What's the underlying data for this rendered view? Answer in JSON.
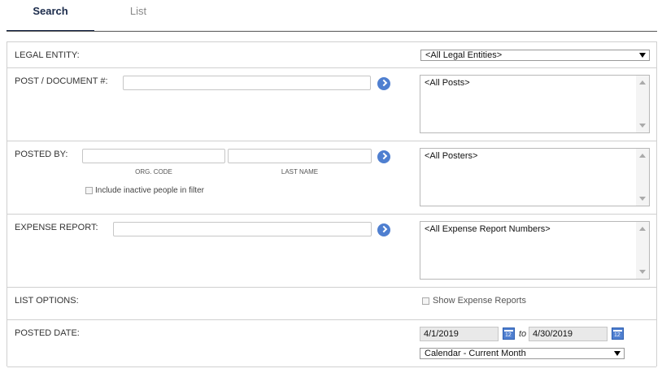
{
  "tabs": {
    "search": "Search",
    "list": "List"
  },
  "legal_entity": {
    "label": "LEGAL ENTITY:",
    "selected": "<All Legal Entities>"
  },
  "post_document": {
    "label": "POST / DOCUMENT #:",
    "value": "",
    "list_items": [
      "<All Posts>"
    ]
  },
  "posted_by": {
    "label": "POSTED BY:",
    "org_code_value": "",
    "last_name_value": "",
    "org_code_label": "ORG. CODE",
    "last_name_label": "LAST NAME",
    "include_inactive_label": "Include inactive people in filter",
    "include_inactive_checked": false,
    "list_items": [
      "<All Posters>"
    ]
  },
  "expense_report": {
    "label": "EXPENSE REPORT:",
    "value": "",
    "list_items": [
      "<All Expense Report Numbers>"
    ]
  },
  "list_options": {
    "label": "LIST OPTIONS:",
    "show_expense_reports_label": "Show Expense Reports",
    "show_expense_reports_checked": false
  },
  "posted_date": {
    "label": "POSTED DATE:",
    "from": "4/1/2019",
    "to_label": "to",
    "to": "4/30/2019",
    "range_selected": "Calendar - Current Month"
  },
  "colors": {
    "accent": "#4f7fd0",
    "tab_active": "#1a2a4a"
  }
}
